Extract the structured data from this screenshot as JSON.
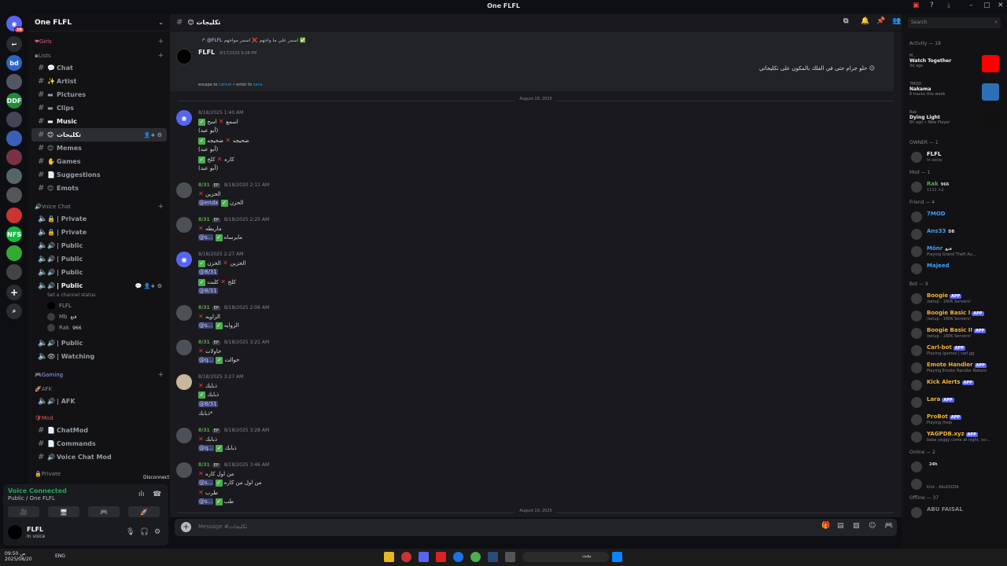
{
  "window": {
    "title": "One FLFL",
    "controls": [
      "–",
      "▢",
      "✕"
    ]
  },
  "servers": [
    {
      "label": "16",
      "badge": "16"
    },
    {
      "label": "↩"
    },
    {
      "label": "bd"
    },
    {
      "label": ""
    },
    {
      "label": "DDF"
    },
    {
      "label": ""
    },
    {
      "label": ""
    },
    {
      "label": ""
    },
    {
      "label": ""
    },
    {
      "label": ""
    },
    {
      "label": ""
    },
    {
      "label": "NFS"
    },
    {
      "label": ""
    },
    {
      "label": ""
    },
    {
      "label": ""
    },
    {
      "label": "+"
    },
    {
      "label": "⌕"
    }
  ],
  "sidebar": {
    "server_name": "One FLFL",
    "categories": {
      "girls": "Girls",
      "lists": "Lists",
      "voice": "Voice Chat",
      "gaming": "Gaming",
      "afk": "AFK",
      "mod": "Mod",
      "private": "Private"
    },
    "text_channels": [
      {
        "emoji": "💬",
        "label": "Chat"
      },
      {
        "emoji": "✨",
        "label": "Artist"
      },
      {
        "emoji": "▬",
        "label": "Pictures"
      },
      {
        "emoji": "▬",
        "label": "Clips"
      },
      {
        "emoji": "▬",
        "label": "Music"
      },
      {
        "emoji": "😊",
        "label": "تكليجات"
      },
      {
        "emoji": "😊",
        "label": "Memes"
      },
      {
        "emoji": "✋",
        "label": "Games"
      },
      {
        "emoji": "📄",
        "label": "Suggestions"
      },
      {
        "emoji": "😊",
        "label": "Emots"
      }
    ],
    "voice_channels": [
      {
        "emoji": "🔒",
        "label": "| Private"
      },
      {
        "emoji": "🔒",
        "label": "| Private"
      },
      {
        "emoji": "🔊",
        "label": "| Public"
      },
      {
        "emoji": "🔊",
        "label": "| Public"
      },
      {
        "emoji": "🔊",
        "label": "| Public"
      },
      {
        "emoji": "🔊",
        "label": "| Public"
      }
    ],
    "channel_status": "Set a channel status",
    "voice_users": [
      {
        "name": "FLFL",
        "tag": ""
      },
      {
        "name": "Mb",
        "tag": "قنع"
      },
      {
        "name": "Rak",
        "tag": "966"
      }
    ],
    "voice_channels_2": [
      {
        "emoji": "🔊",
        "label": "| Public"
      },
      {
        "emoji": "👁",
        "label": "| Watching"
      }
    ],
    "afk_channel": {
      "emoji": "🔊",
      "label": "| AFK"
    },
    "mod_channels": [
      {
        "emoji": "📄",
        "label": "ChatMod"
      },
      {
        "emoji": "📄",
        "label": "Commands"
      },
      {
        "emoji": "🔊",
        "label": "Voice Chat Mod"
      }
    ]
  },
  "voice_panel": {
    "status": "Voice Connected",
    "sub": "Public / One FLFL",
    "tooltip": "Disconnect",
    "buttons": [
      "🎥",
      "🖥",
      "🎮",
      "🚀"
    ]
  },
  "user": {
    "name": "FLFL",
    "status": "In voice"
  },
  "chat": {
    "channel_name": "تكليجات",
    "placeholder": "Message #تكليجات",
    "edit": {
      "reply_name": "@FLFL",
      "reply_text": "اسمر علي ما واجهم ❌ اسمر مواجهم ✅",
      "author": "FLFL",
      "time": "8/17/2025 9:28 PM",
      "text": "حلو جرام حتى في الفلك بالمكون على تكليجاتي",
      "hint_escape": "escape to",
      "hint_cancel": "cancel",
      "hint_enter": " • enter to",
      "hint_save": "save"
    },
    "date1": "August 18, 2025",
    "date2": "August 19, 2025",
    "messages": [
      {
        "name": "",
        "time": "8/18/2025 1:40 AM",
        "avatar": "blue",
        "lines": [
          {
            "ok": true,
            "t": "اسمع",
            "x": true,
            "t2": "اسح"
          },
          {
            "t": "(أبو عبد)"
          },
          {
            "ok": true,
            "t": "ضحيجه",
            "x": true,
            "t2": "ضحيجه"
          },
          {
            "t": "(أبو عبد)"
          },
          {
            "ok": true,
            "t": "كاره",
            "x": true,
            "t2": "كلخ"
          },
          {
            "t": "(أبو عبد)"
          }
        ]
      },
      {
        "name": "8/31",
        "badge": "EP",
        "time": "8/18/2020 2:11 AM",
        "avatar": "gray",
        "lines": [
          {
            "x": true,
            "t": "الحزين"
          },
          {
            "mention": "@endx",
            "ok": true,
            "t": "الحزن"
          }
        ]
      },
      {
        "name": "8/31",
        "badge": "EP",
        "time": "8/18/2025 2:25 AM",
        "avatar": "gray",
        "lines": [
          {
            "x": true,
            "t": "ماريطه"
          },
          {
            "mention": "@s...",
            "ok": true,
            "t": "مايرساه"
          }
        ]
      },
      {
        "name": "",
        "time": "8/18/2025 2:27 AM",
        "avatar": "blue",
        "lines": [
          {
            "ok": true,
            "t": "الحزين",
            "x": true,
            "t2": "الحزن"
          },
          {
            "mention": "@8/31"
          },
          {
            "ok": true,
            "t": "كلخ",
            "x": true,
            "t2": "كلبت"
          },
          {
            "mention": "@8/31"
          }
        ]
      },
      {
        "name": "8/31",
        "badge": "EP",
        "time": "8/18/2025 2:06 AM",
        "avatar": "gray",
        "lines": [
          {
            "x": true,
            "t": "الزاويه"
          },
          {
            "mention": "@s...",
            "ok": true,
            "t": "الزوايه"
          }
        ]
      },
      {
        "name": "8/31",
        "badge": "EP",
        "time": "8/18/2025 3:21 AM",
        "avatar": "gray",
        "lines": [
          {
            "x": true,
            "t": "حاولات"
          },
          {
            "mention": "@q...",
            "ok": true,
            "t": "حوالت"
          }
        ]
      },
      {
        "name": "",
        "time": "8/18/2025 3:27 AM",
        "avatar": "cream",
        "lines": [
          {
            "x": true,
            "t": "ذبايك"
          },
          {
            "ok": true,
            "t": "ذبايك"
          },
          {
            "mention": "@8/31"
          },
          {
            "t": "ذبابك*"
          }
        ]
      },
      {
        "name": "8/31",
        "badge": "EP",
        "time": "8/18/2025 3:28 AM",
        "avatar": "gray",
        "lines": [
          {
            "x": true,
            "t": "ذبابك"
          },
          {
            "mention": "@q...",
            "ok": true,
            "t": "ذبابك"
          }
        ]
      },
      {
        "name": "8/31",
        "badge": "EP",
        "time": "8/18/2025 3:46 AM",
        "avatar": "gray",
        "lines": [
          {
            "x": true,
            "t": "من اول كاره"
          },
          {
            "mention": "@s...",
            "ok": true,
            "t": "من اول من كاره"
          },
          {
            "x": true,
            "t": "طرب"
          },
          {
            "mention": "@s...",
            "ok": true,
            "t": "طب"
          }
        ]
      }
    ]
  },
  "rightpane": {
    "search_placeholder": "Search",
    "activity_header": "Activity — 18",
    "activities": [
      {
        "who": "M...",
        "title": "Watch Together",
        "sub": "3d ago",
        "color": "#ff0000"
      },
      {
        "who": "7MOD",
        "title": "Nakama",
        "sub": "6 tracks this week",
        "color": "#2d6fb5"
      },
      {
        "who": "Rak",
        "title": "Dying Light",
        "sub": "6h ago • New Player",
        "color": "#111111"
      }
    ],
    "owner_header": "OWNER — 1",
    "owner": {
      "name": "FLFL",
      "sub": "In voice",
      "color": "#f2f3f5"
    },
    "mod_header": "Mod — 1",
    "mod": {
      "name": "Rak",
      "tag": "966",
      "sub": "1111 +2",
      "color": "#5da54a"
    },
    "friend_header": "Friend — 4",
    "friends": [
      {
        "name": "7MOD",
        "sub": "",
        "color": "#3ba0ff"
      },
      {
        "name": "Ans33",
        "sub": "",
        "tag": "DB",
        "color": "#3ba0ff"
      },
      {
        "name": "Mönr",
        "sub": "Playing Grand Theft Au...",
        "tag": "قنع",
        "color": "#3ba0ff"
      },
      {
        "name": "Majeed",
        "sub": "",
        "color": "#3ba0ff"
      }
    ],
    "bot_header": "Bot — 9",
    "bots": [
      {
        "name": "Boogie",
        "sub": "/setup - 160K Servers!",
        "color": "#f0b232"
      },
      {
        "name": "Boogie Basic I",
        "sub": "/setup - 160K Servers!",
        "color": "#f0b232"
      },
      {
        "name": "Boogie Basic II",
        "sub": "/setup - 160K Servers!",
        "color": "#f0b232"
      },
      {
        "name": "Carl-bot",
        "sub": "Playing /games | carl.gg",
        "color": "#f0b232"
      },
      {
        "name": "Emote Handler",
        "sub": "Playing Emote Handler Reborn",
        "color": "#f0b232"
      },
      {
        "name": "Kick Alerts",
        "sub": "",
        "color": "#f0b232"
      },
      {
        "name": "Lara",
        "sub": "",
        "color": "#f0b232"
      },
      {
        "name": "ProBot",
        "sub": "Playing /help",
        "color": "#f0b232"
      },
      {
        "name": "YAGPDB.xyz",
        "sub": "baba yaggy come at night, scr...",
        "color": "#f0b232"
      }
    ],
    "app_label": "APP",
    "online_header": "Online — 2",
    "online": [
      {
        "name": "",
        "tag": "24h",
        "sub": "",
        "color": "#f2f3f5"
      },
      {
        "name": "",
        "sub": "Kick : AbuDUZIA",
        "color": "#f2f3f5"
      }
    ],
    "offline_header": "Offline — 37",
    "offline": [
      {
        "name": "ABU FAISAL",
        "color": "#80848e"
      }
    ]
  },
  "taskbar": {
    "time": "09:50 ص",
    "date": "2025/08/20",
    "lang": "ENG",
    "search_text": "بحث"
  },
  "colors": {
    "accent": "#5865f2",
    "green": "#23a55a",
    "red": "#f23f43"
  }
}
